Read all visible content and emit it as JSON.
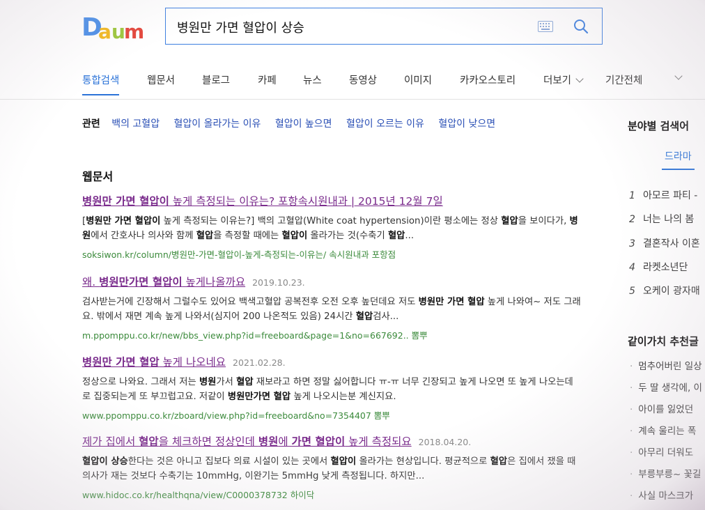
{
  "search": {
    "query": "병원만 가면 혈압이 상승"
  },
  "logo": {
    "letters": [
      "D",
      "a",
      "u",
      "m"
    ],
    "colors": [
      "#4a8ee8",
      "#f2b81e",
      "#e4453a",
      "#e4453a"
    ]
  },
  "tabs": [
    {
      "label": "통합검색",
      "active": true
    },
    {
      "label": "웹문서"
    },
    {
      "label": "블로그"
    },
    {
      "label": "카페"
    },
    {
      "label": "뉴스"
    },
    {
      "label": "동영상"
    },
    {
      "label": "이미지"
    },
    {
      "label": "카카오스토리"
    },
    {
      "label": "더보기"
    },
    {
      "label": "기간전체"
    }
  ],
  "related": {
    "label": "관련",
    "items": [
      "백의 고혈압",
      "혈압이 올라가는 이유",
      "혈압이 높으면",
      "혈압이 오르는 이유",
      "혈압이 낮으면"
    ]
  },
  "section_title": "웹문서",
  "results": [
    {
      "title_parts": [
        {
          "t": "병원만 가면 혈압이",
          "b": true
        },
        {
          "t": " 높게 측정되는 이유는? 포항속시원내과 | 2015년 12월 7일",
          "b": false
        }
      ],
      "date": "",
      "snippet_parts": [
        {
          "t": "[",
          "b": false
        },
        {
          "t": "병원만 가면 혈압이",
          "b": true
        },
        {
          "t": " 높게 측정되는 이유는?] 백의 고혈압(White coat hypertension)이란 평소에는 정상 ",
          "b": false
        },
        {
          "t": "혈압",
          "b": true
        },
        {
          "t": "을 보이다가, ",
          "b": false
        },
        {
          "t": "병원",
          "b": true
        },
        {
          "t": "에서 간호사나 의사와 함께 ",
          "b": false
        },
        {
          "t": "혈압",
          "b": true
        },
        {
          "t": "을 측정할 때에는 ",
          "b": false
        },
        {
          "t": "혈압이",
          "b": true
        },
        {
          "t": " 올라가는 것(수축기 ",
          "b": false
        },
        {
          "t": "혈압",
          "b": true
        },
        {
          "t": "...",
          "b": false
        }
      ],
      "url": "soksiwon.kr/column/병원만-가면-혈압이-높게-측정되는-이유는/ 속시원내과 포항점"
    },
    {
      "title_parts": [
        {
          "t": "왜. ",
          "b": false
        },
        {
          "t": "병원만가면 혈압이",
          "b": true
        },
        {
          "t": " 높게나올까요",
          "b": false
        }
      ],
      "date": "2019.10.23.",
      "snippet_parts": [
        {
          "t": "검사받는거에 긴장해서 그럴수도 있어요 백색고혈압 공복전후 오전 오후 높던데요 저도 ",
          "b": false
        },
        {
          "t": "병원만 가면 혈압",
          "b": true
        },
        {
          "t": " 높게 나와여~ 저도 그래요. 밖에서 재면 계속 높게 나와서(심지어 200 나온적도 있음) 24시간 ",
          "b": false
        },
        {
          "t": "혈압",
          "b": true
        },
        {
          "t": "검사...",
          "b": false
        }
      ],
      "url": "m.ppomppu.co.kr/new/bbs_view.php?id=freeboard&page=1&no=667692.. 뽐뿌"
    },
    {
      "title_parts": [
        {
          "t": "병원만 가면 혈압",
          "b": true
        },
        {
          "t": " 높게 나오네요",
          "b": false
        }
      ],
      "date": "2021.02.28.",
      "snippet_parts": [
        {
          "t": "정상으로 나와요. 그래서 저는 ",
          "b": false
        },
        {
          "t": "병원",
          "b": true
        },
        {
          "t": "가서 ",
          "b": false
        },
        {
          "t": "혈압",
          "b": true
        },
        {
          "t": " 재보라고 하면 정말 싫어합니다 ㅠ-ㅠ 너무 긴장되고 높게 나오면 또 높게 나오는데로 집중되는게 또 부끄럽고요. 저같이 ",
          "b": false
        },
        {
          "t": "병원만가면 혈압",
          "b": true
        },
        {
          "t": " 높게 나오시는분 계신지요.",
          "b": false
        }
      ],
      "url": "www.ppomppu.co.kr/zboard/view.php?id=freeboard&no=7354407 뽐뿌"
    },
    {
      "title_parts": [
        {
          "t": "제가 집에서 ",
          "b": false
        },
        {
          "t": "혈압",
          "b": true
        },
        {
          "t": "을 체크하면 정상인데 ",
          "b": false
        },
        {
          "t": "병원",
          "b": true
        },
        {
          "t": "에 ",
          "b": false
        },
        {
          "t": "가면 혈압이",
          "b": true
        },
        {
          "t": " 높게 측정되요",
          "b": false
        }
      ],
      "date": "2018.04.20.",
      "snippet_parts": [
        {
          "t": "혈압이 상승",
          "b": true
        },
        {
          "t": "한다는 것은 아니고 집보다 의료 시설이 있는 곳에서 ",
          "b": false
        },
        {
          "t": "혈압이",
          "b": true
        },
        {
          "t": " 올라가는 현상입니다. 평균적으로 ",
          "b": false
        },
        {
          "t": "혈압",
          "b": true
        },
        {
          "t": "은 집에서 쟀을 때 의사가 재는 것보다 수축기는 10mmHg, 이완기는 5mmHg 낮게 측정됩니다. 하지만...",
          "b": false
        }
      ],
      "url": "www.hidoc.co.kr/healthqna/view/C0000378732 하이닥"
    }
  ],
  "sidebar": {
    "title1": "분야별 검색어",
    "tab": "드라마",
    "ranks": [
      {
        "num": "1",
        "label": "아모르 파티 -"
      },
      {
        "num": "2",
        "label": "너는 나의 봄"
      },
      {
        "num": "3",
        "label": "결혼작사 이혼"
      },
      {
        "num": "4",
        "label": "라켓소년단"
      },
      {
        "num": "5",
        "label": "오케이 광자매"
      }
    ],
    "title2": "같이가치 추천글",
    "bullets": [
      "멈추어버린 일상",
      "두 딸 생각에, 이",
      "아이를 잃었던",
      "계속 울리는 폭",
      "아무리 더워도",
      "부릉부릉~ 꽃길",
      "사실 마스크가"
    ]
  }
}
